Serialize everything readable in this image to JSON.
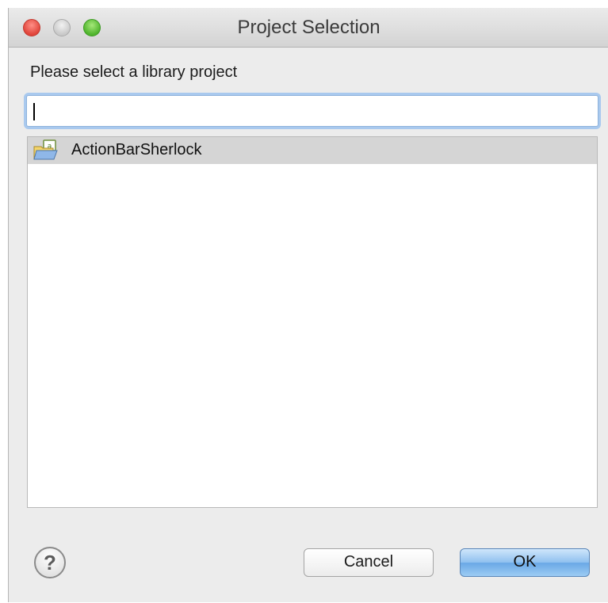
{
  "window": {
    "title": "Project Selection"
  },
  "dialog": {
    "prompt": "Please select a library project",
    "filter": {
      "value": "",
      "placeholder": ""
    },
    "projects": [
      {
        "label": "ActionBarSherlock",
        "icon": "library-project-folder-icon",
        "selected": true
      }
    ]
  },
  "buttons": {
    "help_label": "?",
    "cancel_label": "Cancel",
    "ok_label": "OK"
  },
  "colors": {
    "selection": "#d5d5d5",
    "focus_ring": "#a9c9ee",
    "default_button": "#6aa8e6"
  }
}
